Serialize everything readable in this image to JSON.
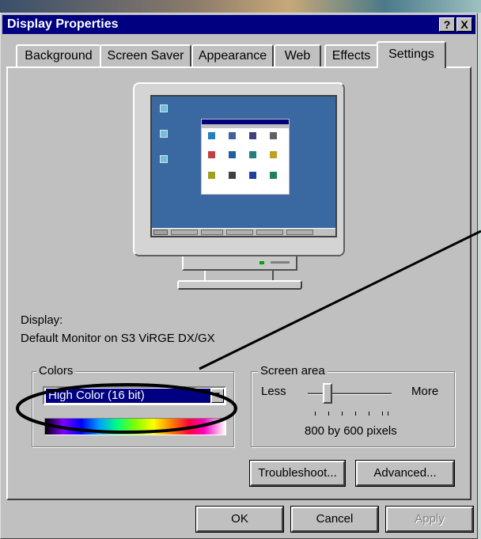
{
  "window": {
    "title": "Display Properties",
    "help_button": "?",
    "close_button": "X"
  },
  "tabs": [
    {
      "label": "Background",
      "active": false
    },
    {
      "label": "Screen Saver",
      "active": false
    },
    {
      "label": "Appearance",
      "active": false
    },
    {
      "label": "Web",
      "active": false
    },
    {
      "label": "Effects",
      "active": false
    },
    {
      "label": "Settings",
      "active": true
    }
  ],
  "display": {
    "label": "Display:",
    "value": "Default Monitor on S3 ViRGE DX/GX"
  },
  "colors": {
    "group_label": "Colors",
    "selected": "High Color (16 bit)",
    "dropdown_arrow": "▼"
  },
  "screen_area": {
    "group_label": "Screen area",
    "less_label": "Less",
    "more_label": "More",
    "resolution_text": "800 by 600 pixels",
    "slider_position_fraction": 0.3,
    "tick_count": 7
  },
  "buttons": {
    "troubleshoot": "Troubleshoot...",
    "advanced": "Advanced...",
    "ok": "OK",
    "cancel": "Cancel",
    "apply": "Apply"
  },
  "theme": {
    "title_bar_color": "#000080",
    "dialog_face": "#c0c0c0",
    "desktop_preview": "#3a68a0",
    "annotation_color": "#000000"
  },
  "icons": [
    "help-icon",
    "close-icon",
    "dropdown-arrow-icon",
    "monitor-preview-icon"
  ]
}
